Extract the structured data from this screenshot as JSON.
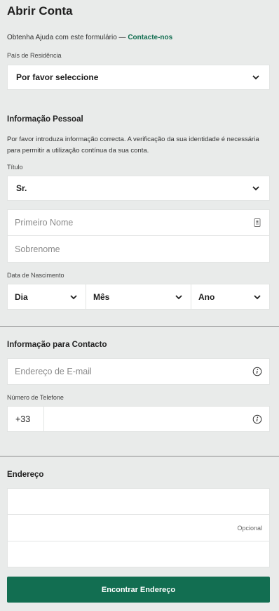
{
  "header": {
    "title": "Abrir Conta",
    "help_text": "Obtenha Ajuda com este formulário — ",
    "help_link": "Contacte-nos"
  },
  "residence": {
    "label": "País de Residência",
    "selected": "Por favor seleccione"
  },
  "personal": {
    "heading": "Informação Pessoal",
    "notice": "Por favor introduza informação correcta. A verificação da sua identidade é necessária para permitir a utilização contínua da sua conta.",
    "title_label": "Título",
    "title_selected": "Sr.",
    "first_name_placeholder": "Primeiro Nome",
    "last_name_placeholder": "Sobrenome",
    "dob_label": "Data de Nascimento",
    "dob_day": "Dia",
    "dob_month": "Mês",
    "dob_year": "Ano"
  },
  "contact": {
    "heading": "Informação para Contacto",
    "email_placeholder": "Endereço de E-mail",
    "phone_label": "Número de Telefone",
    "phone_prefix": "+33",
    "phone_value": ""
  },
  "address": {
    "heading": "Endereço",
    "line1_value": "",
    "line2_hint": "Opcional",
    "line3_value": "",
    "find_button": "Encontrar Endereço"
  },
  "colors": {
    "accent": "#126e51",
    "background": "#e9ebea"
  },
  "icons": {
    "chevron": "chevron-down-icon",
    "info": "info-icon",
    "autofill": "autofill-icon"
  }
}
